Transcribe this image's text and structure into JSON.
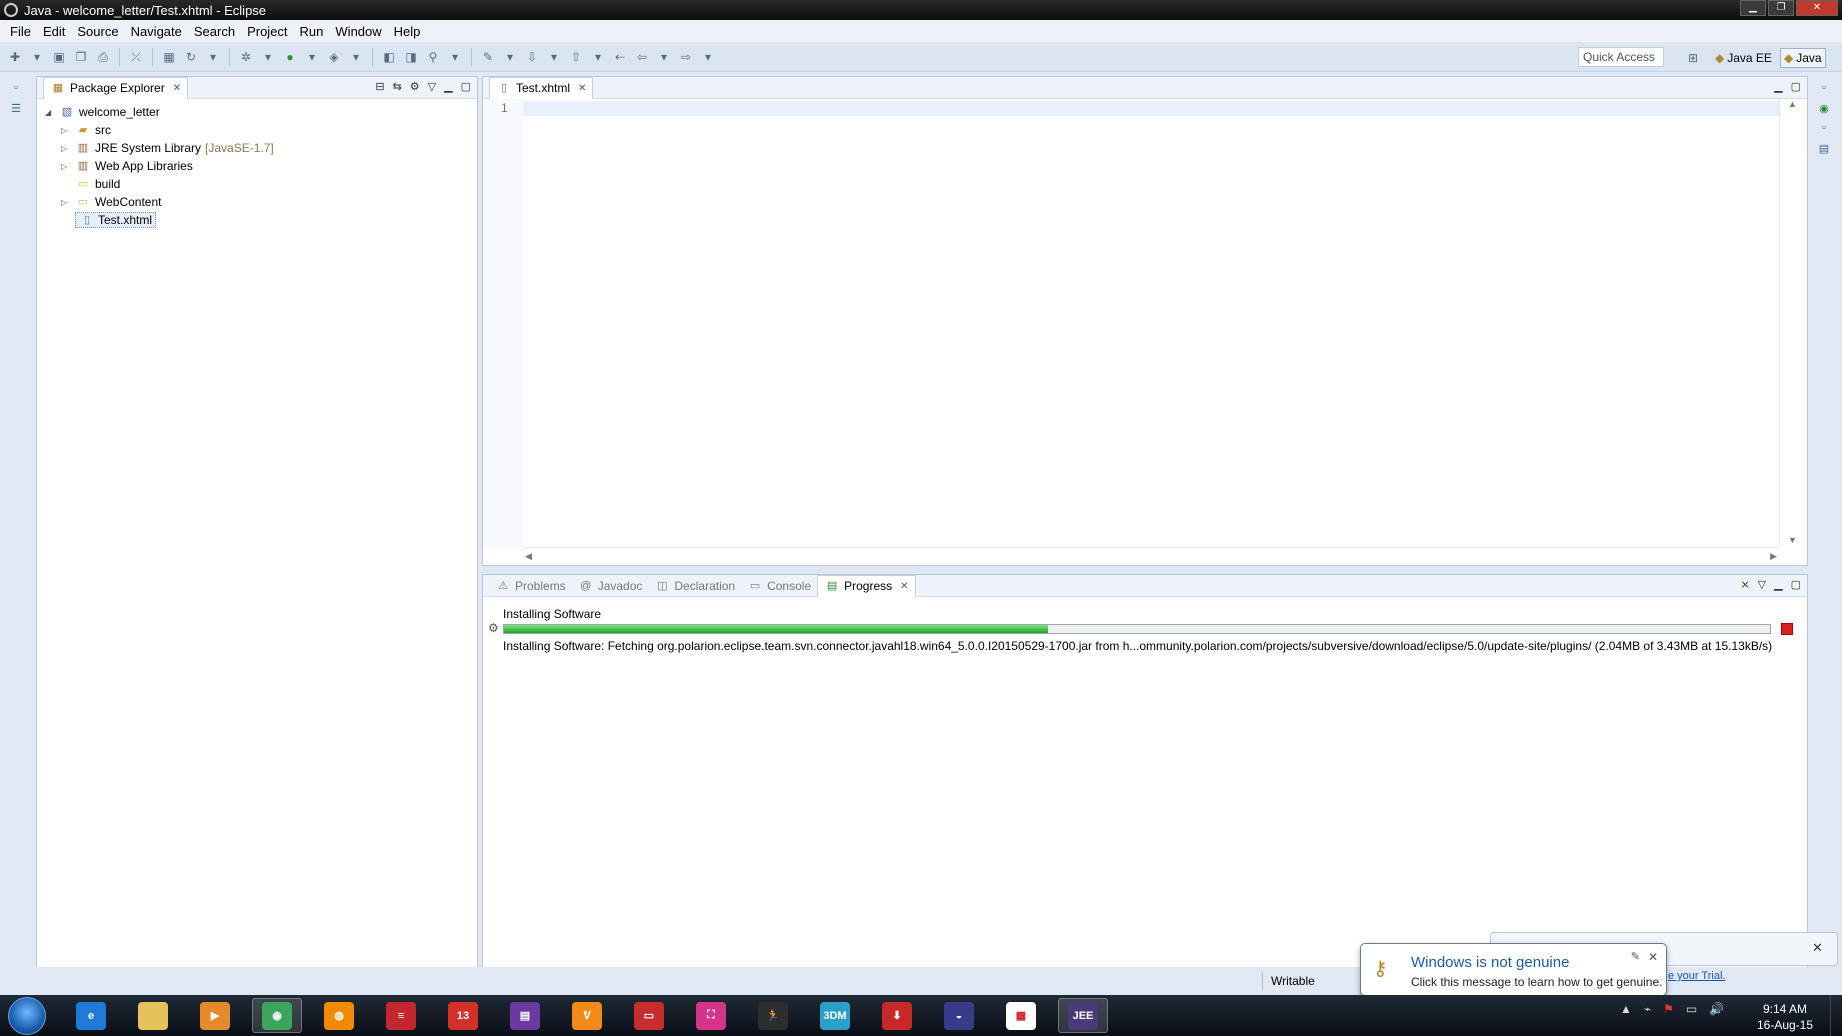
{
  "window": {
    "title": "Java - welcome_letter/Test.xhtml - Eclipse",
    "controls": [
      "▁",
      "❐",
      "✕"
    ]
  },
  "menu": [
    "File",
    "Edit",
    "Source",
    "Navigate",
    "Search",
    "Project",
    "Run",
    "Window",
    "Help"
  ],
  "toolbar": {
    "quick_access": "Quick Access",
    "perspectives": [
      {
        "label": "Java EE",
        "active": false
      },
      {
        "label": "Java",
        "active": true
      }
    ]
  },
  "package_explorer": {
    "title": "Package Explorer",
    "project": "welcome_letter",
    "items": [
      {
        "label": "src",
        "expandable": true,
        "icon": "package-folder-icon"
      },
      {
        "label": "JRE System Library",
        "suffix": "[JavaSE-1.7]",
        "expandable": true,
        "icon": "library-icon"
      },
      {
        "label": "Web App Libraries",
        "expandable": true,
        "icon": "library-icon"
      },
      {
        "label": "build",
        "expandable": false,
        "icon": "folder-icon"
      },
      {
        "label": "WebContent",
        "expandable": true,
        "icon": "folder-icon"
      },
      {
        "label": "Test.xhtml",
        "expandable": false,
        "icon": "file-icon",
        "selected": true
      }
    ]
  },
  "editor": {
    "tab": "Test.xhtml",
    "line_numbers": [
      "1"
    ]
  },
  "bottom_panel": {
    "tabs": [
      {
        "label": "Problems",
        "active": false
      },
      {
        "label": "Javadoc",
        "active": false
      },
      {
        "label": "Declaration",
        "active": false
      },
      {
        "label": "Console",
        "active": false
      },
      {
        "label": "Progress",
        "active": true
      }
    ],
    "progress": {
      "title": "Installing Software",
      "fraction": 0.43,
      "detail": "Installing Software: Fetching org.polarion.eclipse.team.svn.connector.javahl18.win64_5.0.0.I20150529-1700.jar from h...ommunity.polarion.com/projects/subversive/download/eclipse/5.0/update-site/plugins/ (2.04MB of 3.43MB at 15.13kB/s)"
    }
  },
  "status": {
    "writable": "Writable"
  },
  "notification": {
    "title": "Windows is not genuine",
    "message": "Click this message to learn how to get genuine.",
    "background_link": "e your Trial."
  },
  "taskbar": {
    "apps": [
      {
        "name": "internet-explorer",
        "label": "e",
        "color": "#1f7ad6"
      },
      {
        "name": "file-explorer",
        "label": "",
        "color": "#e6c35a"
      },
      {
        "name": "media-player",
        "label": "▶",
        "color": "#e58a2a"
      },
      {
        "name": "chrome",
        "label": "◉",
        "color": "#3ba55c"
      },
      {
        "name": "vlc",
        "label": "◍",
        "color": "#f18a00"
      },
      {
        "name": "app-red-1",
        "label": "≡",
        "color": "#c4262e"
      },
      {
        "name": "app-13",
        "label": "13",
        "color": "#d4302a"
      },
      {
        "name": "winrar",
        "label": "▤",
        "color": "#6a3aa0"
      },
      {
        "name": "app-orange",
        "label": "ᕓ",
        "color": "#f08a18"
      },
      {
        "name": "app-red-2",
        "label": "▭",
        "color": "#c72d2d"
      },
      {
        "name": "app-2012",
        "label": "⛶",
        "color": "#d4358a"
      },
      {
        "name": "app-runner",
        "label": "🏃",
        "color": "#2d2d2d"
      },
      {
        "name": "app-3dm",
        "label": "3DM",
        "color": "#2aa0c8"
      },
      {
        "name": "app-pdf",
        "label": "⬇",
        "color": "#c82828"
      },
      {
        "name": "eclipse",
        "label": "◒",
        "color": "#3a3a8a"
      },
      {
        "name": "app-grid",
        "label": "▦",
        "color": "#ffffff"
      },
      {
        "name": "eclipse-jee",
        "label": "JEE",
        "color": "#4a3a7a"
      }
    ],
    "clock_time": "9:14 AM",
    "clock_date": "16-Aug-15"
  }
}
